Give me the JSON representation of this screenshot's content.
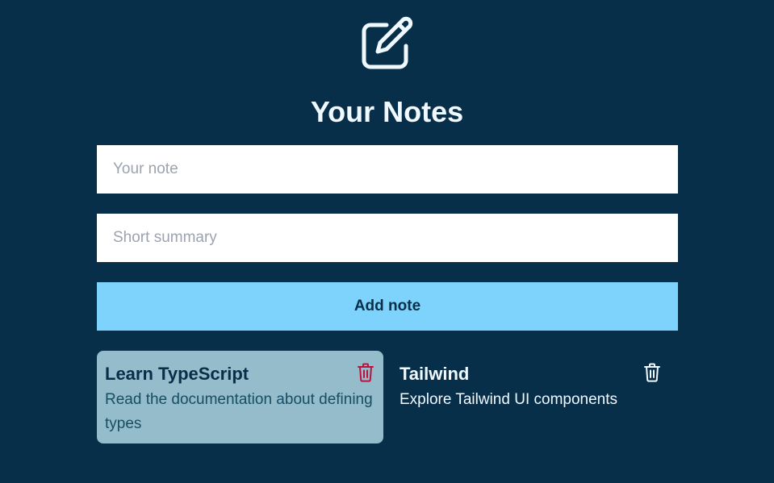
{
  "header": {
    "logo_icon": "pencil-square-icon",
    "title": "Your Notes"
  },
  "form": {
    "note_placeholder": "Your note",
    "note_value": "",
    "summary_placeholder": "Short summary",
    "summary_value": "",
    "add_label": "Add note"
  },
  "notes": [
    {
      "title": "Learn TypeScript",
      "summary": "Read the documentation about defining types",
      "selected": true,
      "delete_icon": "trash-icon",
      "delete_color": "#be123c"
    },
    {
      "title": "Tailwind",
      "summary": "Explore Tailwind UI components",
      "selected": false,
      "delete_icon": "trash-icon",
      "delete_color": "#f0f9ff"
    }
  ],
  "colors": {
    "background": "#082f49",
    "accent": "#7dd3fc",
    "selected_card": "#94bccb",
    "text_light": "#f0f9ff"
  }
}
